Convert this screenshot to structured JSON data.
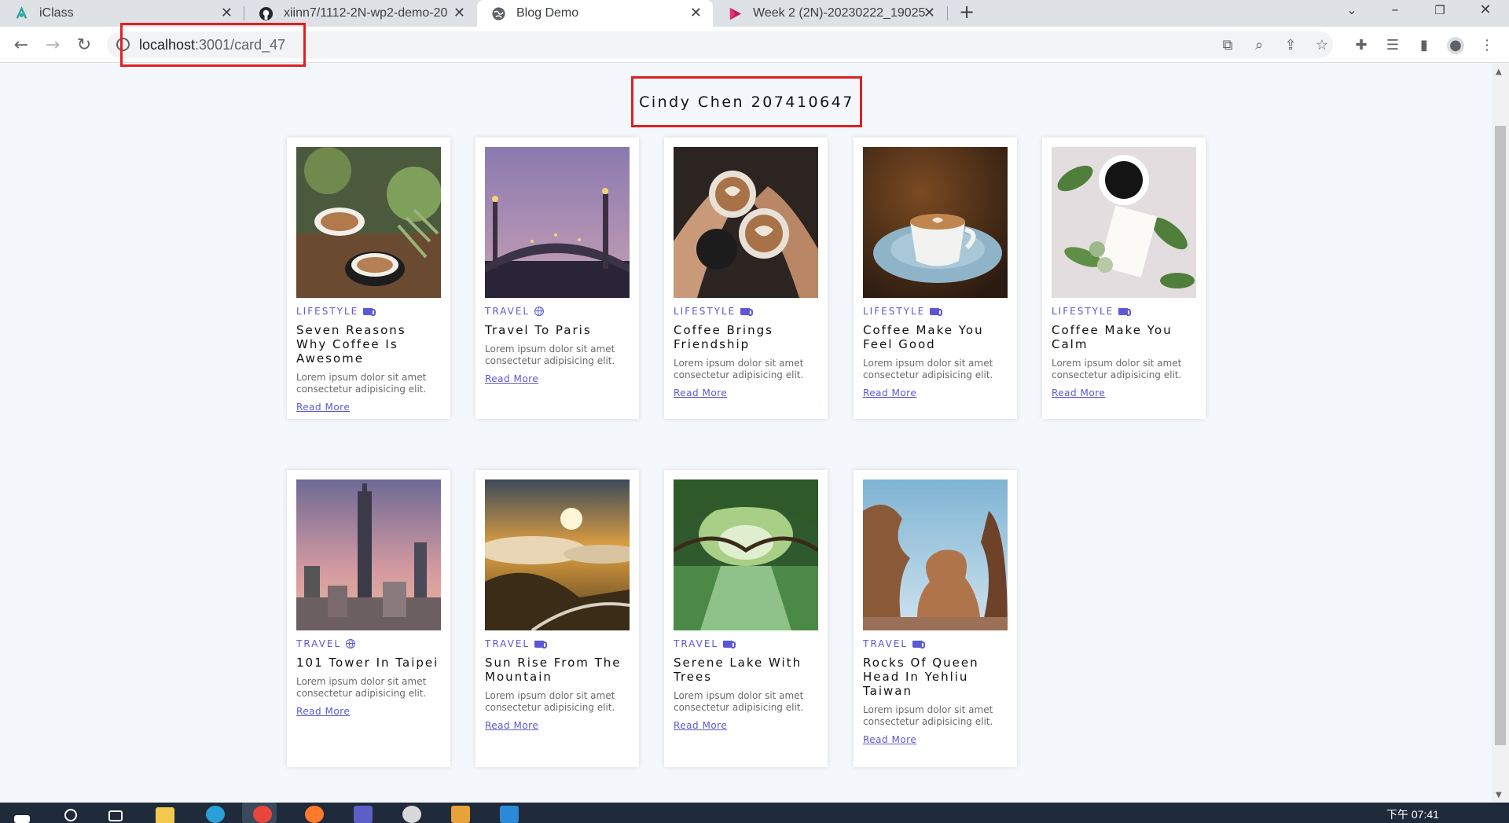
{
  "browser": {
    "tabs": [
      {
        "title": "iClass",
        "close": "✕"
      },
      {
        "title": "xiinn7/1112-2N-wp2-demo-20",
        "close": "✕"
      },
      {
        "title": "Blog Demo",
        "close": "✕"
      },
      {
        "title": "Week 2 (2N)-20230222_19025",
        "close": "✕"
      }
    ],
    "new_tab": "+",
    "url_host": "localhost",
    "url_path": ":3001/card_47"
  },
  "page": {
    "title": "Cindy Chen 207410647"
  },
  "cards": [
    {
      "category": "LIFESTYLE",
      "icon": "coffee-cup-icon",
      "title": "Seven Reasons Why Coffee Is Awesome",
      "desc": "Lorem ipsum dolor sit amet consectetur adipisicing elit.",
      "link": "Read More",
      "image": "coffee-cups-plants"
    },
    {
      "category": "TRAVEL",
      "icon": "globe-icon",
      "title": "Travel To Paris",
      "desc": "Lorem ipsum dolor sit amet consectetur adipisicing elit.",
      "link": "Read More",
      "image": "paris-bridge-dusk"
    },
    {
      "category": "LIFESTYLE",
      "icon": "coffee-cup-icon",
      "title": "Coffee Brings Friendship",
      "desc": "Lorem ipsum dolor sit amet consectetur adipisicing elit.",
      "link": "Read More",
      "image": "latte-art-cheers"
    },
    {
      "category": "LIFESTYLE",
      "icon": "coffee-cup-icon",
      "title": "Coffee Make You Feel Good",
      "desc": "Lorem ipsum dolor sit amet consectetur adipisicing elit.",
      "link": "Read More",
      "image": "coffee-blue-saucer"
    },
    {
      "category": "LIFESTYLE",
      "icon": "coffee-cup-icon",
      "title": "Coffee Make You Calm",
      "desc": "Lorem ipsum dolor sit amet consectetur adipisicing elit.",
      "link": "Read More",
      "image": "coffee-flatlay-leaves"
    },
    {
      "category": "TRAVEL",
      "icon": "globe-icon",
      "title": "101 Tower In Taipei",
      "desc": "Lorem ipsum dolor sit amet consectetur adipisicing elit.",
      "link": "Read More",
      "image": "taipei-101-skyline"
    },
    {
      "category": "TRAVEL",
      "icon": "coffee-cup-icon",
      "title": "Sun Rise From The Mountain",
      "desc": "Lorem ipsum dolor sit amet consectetur adipisicing elit.",
      "link": "Read More",
      "image": "mountain-sunrise"
    },
    {
      "category": "TRAVEL",
      "icon": "coffee-cup-icon",
      "title": "Serene Lake With Trees",
      "desc": "Lorem ipsum dolor sit amet consectetur adipisicing elit.",
      "link": "Read More",
      "image": "green-tree-tunnel-lake"
    },
    {
      "category": "TRAVEL",
      "icon": "coffee-cup-icon",
      "title": "Rocks Of Queen Head In Yehliu Taiwan",
      "desc": "Lorem ipsum dolor sit amet consectetur adipisicing elit.",
      "link": "Read More",
      "image": "queens-head-rock"
    }
  ],
  "taskbar": {
    "clock": "下午 07:41"
  }
}
